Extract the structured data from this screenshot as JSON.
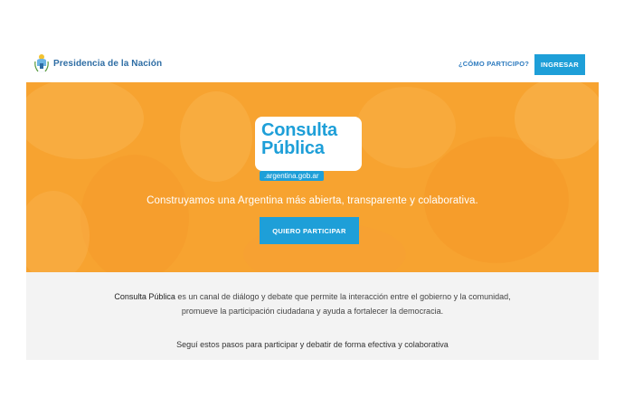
{
  "header": {
    "brand": "Presidencia de la Nación",
    "nav_link": "¿CÓMO PARTICIPO?",
    "login_label": "INGRESAR"
  },
  "hero": {
    "logo_line1": "Consulta",
    "logo_line2": "Pública",
    "logo_domain": ".argentina.gob.ar",
    "tagline": "Construyamos una Argentina más abierta, transparente y colaborativa.",
    "cta_label": "QUIERO PARTICIPAR"
  },
  "intro": {
    "name": "Consulta Pública",
    "line1_rest": " es un canal de diálogo y debate que permite la interacción entre el gobierno y la comunidad,",
    "line2": "promueve la participación ciudadana y ayuda a fortalecer la democracia.",
    "steps": "Seguí estos pasos para participar y debatir de forma efectiva y colaborativa"
  },
  "colors": {
    "hero_orange": "#f7a330",
    "accent_blue": "#1e9fd8",
    "brand_blue": "#2e6da4",
    "intro_bg": "#f3f3f3"
  },
  "icons": {
    "brand": "argentina-coat-of-arms-icon"
  }
}
